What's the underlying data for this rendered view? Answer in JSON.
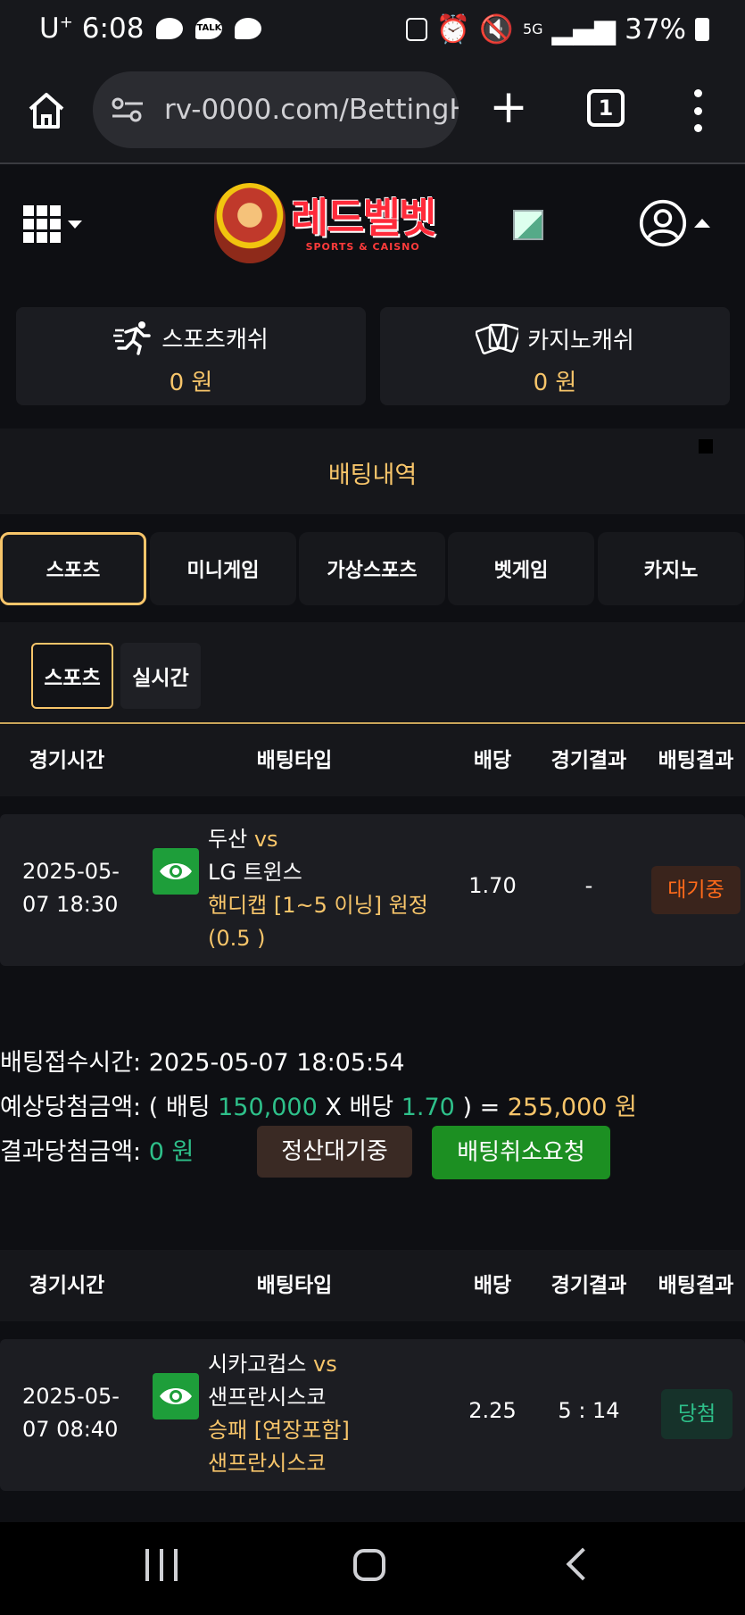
{
  "status_bar": {
    "carrier": "U",
    "carrier_sup": "+",
    "time": "6:08",
    "talk_label": "TALK",
    "network": "5G",
    "battery": "37%"
  },
  "browser": {
    "url": "rv-0000.com/BettingH",
    "tab_count": "1"
  },
  "site": {
    "logo_text": "레드벨벳",
    "logo_sub": "SPORTS & CAISNO"
  },
  "wallet": {
    "sports_label": "스포츠캐쉬",
    "sports_value": "0 원",
    "casino_label": "카지노캐쉬",
    "casino_value": "0 원"
  },
  "page_title": "배팅내역",
  "category_tabs": [
    "스포츠",
    "미니게임",
    "가상스포츠",
    "벳게임",
    "카지노"
  ],
  "sub_tabs": [
    "스포츠",
    "실시간"
  ],
  "table_headers": {
    "time": "경기시간",
    "type": "배팅타입",
    "odds": "배당",
    "game_result": "경기결과",
    "bet_result": "배팅결과"
  },
  "bets": [
    {
      "date": "2025-05-",
      "time": "07 18:30",
      "home": "두산",
      "vs": "vs",
      "away": "LG 트윈스",
      "market_line1": "핸디캡 [1~5 이닝] 원정",
      "market_line2": "(0.5 )",
      "odds": "1.70",
      "game_result": "-",
      "bet_result": "대기중"
    },
    {
      "date": "2025-05-",
      "time": "07 08:40",
      "home": "시카고컵스",
      "vs": "vs",
      "away": "샌프란시스코",
      "market_line1": "승패 [연장포함]",
      "market_line2": "샌프란시스코",
      "odds": "2.25",
      "game_result": "5 : 14",
      "bet_result": "당첨"
    }
  ],
  "bet_info": {
    "received_label": "배팅접수시간:",
    "received_value": "2025-05-07 18:05:54",
    "expected_label": "예상당첨금액:",
    "expected_open": "( 배팅",
    "stake": "150,000",
    "times": "X 배당",
    "odds": "1.70",
    "equals": ") =",
    "payout": "255,000 원",
    "result_label": "결과당첨금액:",
    "result_value": "0 원",
    "settle_status": "정산대기중",
    "cancel_request": "배팅취소요청"
  },
  "colors": {
    "accent_gold": "#f7c56a",
    "win_green": "#2ec08a",
    "pending_orange": "#ff6a1a",
    "cancel_btn": "#1c8f22"
  }
}
